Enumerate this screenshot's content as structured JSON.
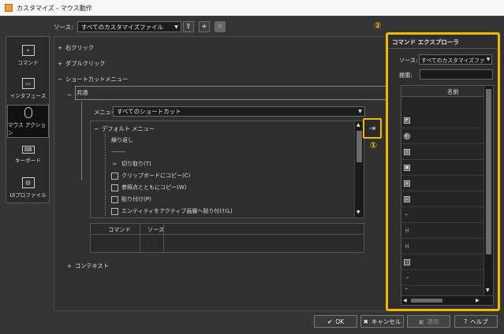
{
  "window": {
    "title": "カスタマイズ - マウス動作"
  },
  "source": {
    "label": "ソース:",
    "value": "すべてのカスタマイズファイル"
  },
  "nav": [
    {
      "label": "コマンド",
      "icon": "command-icon"
    },
    {
      "label": "インタフェース",
      "icon": "interface-icon"
    },
    {
      "label": "マウス アクション",
      "icon": "mouse-icon"
    },
    {
      "label": "キーボード",
      "icon": "keyboard-icon"
    },
    {
      "label": "UIプロファイル",
      "icon": "ui-profile-icon"
    }
  ],
  "tree": {
    "right_click": "右クリック",
    "double_click": "ダブルクリック",
    "shortcut_menu": "ショートカットメニュー",
    "common": "共通",
    "menu_label": "メニュー:",
    "menu_value": "すべてのショートカット",
    "default_menu": "デフォルト メニュー",
    "items": [
      "繰り返し",
      "-------",
      "切り取り(T)",
      "クリップボードにコピー(C)",
      "参照点とともにコピー(W)",
      "貼り付け(P)",
      "エンティティをアクティブ画層へ貼り付け(L)"
    ],
    "table_headers": [
      "コマンド",
      "ソース"
    ],
    "context": "コンテキスト"
  },
  "callouts": {
    "one": "①",
    "two": "②"
  },
  "explorer": {
    "title": "コマンド エクスプローラ",
    "source_label": "ソース:",
    "source_value": "すべてのカスタマイズファイル",
    "search_label": "検索:",
    "search_value": "",
    "column_name": "名前"
  },
  "buttons": {
    "ok": "OK",
    "cancel": "キャンセル",
    "apply": "適用",
    "help": "ヘルプ"
  }
}
